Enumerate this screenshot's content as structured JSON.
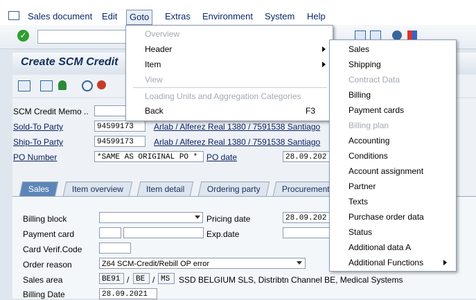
{
  "menubar": {
    "items": [
      "Sales document",
      "Edit",
      "Goto",
      "Extras",
      "Environment",
      "System",
      "Help"
    ]
  },
  "title": "Create SCM Credit",
  "form": {
    "scm_label": "SCM Credit Memo ..",
    "sold_to_label": "Sold-To Party",
    "sold_to_value": "94599173",
    "sold_to_desc": "Arlab / Alferez Real 1380 / 7591538 Santiago",
    "ship_to_label": "Ship-To Party",
    "ship_to_value": "94599173",
    "ship_to_desc": "Arlab / Alferez Real 1380 / 7591538 Santiago",
    "po_number_label": "PO Number",
    "po_number_value": "*SAME AS ORIGINAL PO *",
    "po_date_label": "PO date",
    "po_date_value": "28.09.202"
  },
  "tabs": [
    "Sales",
    "Item overview",
    "Item detail",
    "Ordering party",
    "Procurement"
  ],
  "sales_tab": {
    "billing_block_label": "Billing block",
    "pricing_date_label": "Pricing date",
    "pricing_date_value": "28.09.202",
    "payment_card_label": "Payment card",
    "exp_date_label": "Exp.date",
    "card_verif_label": "Card Verif.Code",
    "order_reason_label": "Order reason",
    "order_reason_value": "Z64 SCM-Credit/Rebill OP error",
    "sales_area_label": "Sales area",
    "sales_org": "BE91",
    "dist_channel": "BE",
    "division": "MS",
    "sep": "/",
    "sales_area_desc": "SSD BELGIUM SLS, Distribtn Channel BE, Medical Systems",
    "billing_date_label": "Billing Date",
    "billing_date_value": "28.09.2021"
  },
  "goto_menu": {
    "items": [
      {
        "label": "Overview",
        "disabled": true
      },
      {
        "label": "Header",
        "disabled": false
      },
      {
        "label": "Item",
        "disabled": false
      },
      {
        "label": "View",
        "disabled": true
      },
      {
        "label": "Loading Units and Aggregation Categories",
        "disabled": true
      },
      {
        "label": "Back",
        "disabled": false,
        "shortcut": "F3"
      }
    ]
  },
  "header_menu": {
    "items": [
      {
        "label": "Sales",
        "disabled": false
      },
      {
        "label": "Shipping",
        "disabled": false
      },
      {
        "label": "Contract Data",
        "disabled": true
      },
      {
        "label": "Billing",
        "disabled": false
      },
      {
        "label": "Payment cards",
        "disabled": false
      },
      {
        "label": "Billing plan",
        "disabled": true
      },
      {
        "label": "Accounting",
        "disabled": false
      },
      {
        "label": "Conditions",
        "disabled": false
      },
      {
        "label": "Account assignment",
        "disabled": false
      },
      {
        "label": "Partner",
        "disabled": false
      },
      {
        "label": "Texts",
        "disabled": false
      },
      {
        "label": "Purchase order data",
        "disabled": false
      },
      {
        "label": "Status",
        "disabled": false
      },
      {
        "label": "Additional data A",
        "disabled": false
      },
      {
        "label": "Additional Functions",
        "disabled": false
      }
    ]
  },
  "colors": {
    "accent": "#5d86b8",
    "success": "#2f9e2f",
    "title_text": "#0f2f5a"
  },
  "icons": [
    "menu-icon",
    "check-icon",
    "chevron-right-icon",
    "dropdown-arrow-icon"
  ]
}
